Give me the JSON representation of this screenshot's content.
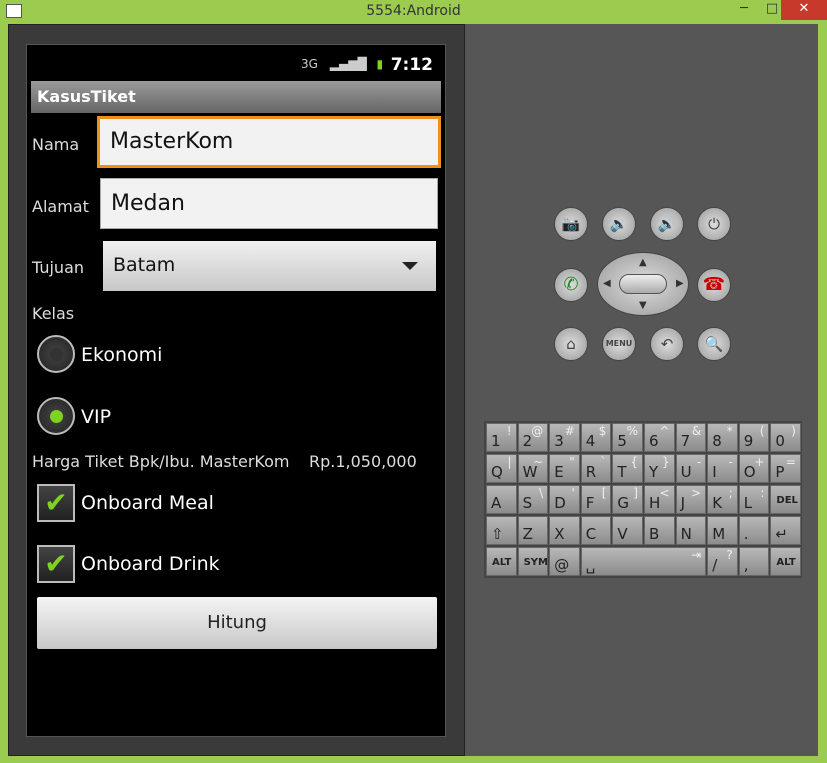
{
  "window": {
    "title": "5554:Android",
    "minimize": "─",
    "maximize": "□",
    "close": "✕"
  },
  "status": {
    "time": "7:12",
    "icons": [
      "3g-icon",
      "signal-icon",
      "battery-charging-icon"
    ]
  },
  "app": {
    "title": "KasusTiket",
    "nama_label": "Nama",
    "nama_value": "MasterKom",
    "alamat_label": "Alamat",
    "alamat_value": "Medan",
    "tujuan_label": "Tujuan",
    "tujuan_value": "Batam",
    "kelas_label": "Kelas",
    "kelas_options": [
      {
        "label": "Ekonomi",
        "selected": false
      },
      {
        "label": "VIP",
        "selected": true
      }
    ],
    "harga_label": "Harga Tiket Bpk/Ibu. MasterKom",
    "harga_value": "Rp.1,050,000",
    "onboard_meal": {
      "label": "Onboard Meal",
      "checked": true
    },
    "onboard_drink": {
      "label": "Onboard Drink",
      "checked": true
    },
    "hitung_label": "Hitung"
  },
  "controls": {
    "menu_label": "MENU"
  },
  "keyboard": {
    "rows": [
      [
        [
          "1",
          "!"
        ],
        [
          "2",
          "@"
        ],
        [
          "3",
          "#"
        ],
        [
          "4",
          "$"
        ],
        [
          "5",
          "%"
        ],
        [
          "6",
          "^"
        ],
        [
          "7",
          "&"
        ],
        [
          "8",
          "*"
        ],
        [
          "9",
          "("
        ],
        [
          "0",
          ")"
        ]
      ],
      [
        [
          "Q",
          "|"
        ],
        [
          "W",
          "~"
        ],
        [
          "E",
          "\""
        ],
        [
          "R",
          "`"
        ],
        [
          "T",
          "{"
        ],
        [
          "Y",
          "}"
        ],
        [
          "U",
          "-"
        ],
        [
          "I",
          "-"
        ],
        [
          "O",
          "+"
        ],
        [
          "P",
          "="
        ]
      ],
      [
        [
          "A",
          ""
        ],
        [
          "S",
          "\\"
        ],
        [
          "D",
          "'"
        ],
        [
          "F",
          "["
        ],
        [
          "G",
          "]"
        ],
        [
          "H",
          "<"
        ],
        [
          "J",
          ">"
        ],
        [
          "K",
          ";"
        ],
        [
          "L",
          ":"
        ],
        [
          "DEL",
          ""
        ]
      ],
      [
        [
          "⇧",
          ""
        ],
        [
          "Z",
          ""
        ],
        [
          "X",
          ""
        ],
        [
          "C",
          ""
        ],
        [
          "V",
          ""
        ],
        [
          "B",
          ""
        ],
        [
          "N",
          ""
        ],
        [
          "M",
          ""
        ],
        [
          ".",
          ""
        ],
        [
          "↵",
          ""
        ]
      ],
      [
        [
          "ALT",
          ""
        ],
        [
          "SYM",
          ""
        ],
        [
          "@",
          ""
        ],
        [
          "␣",
          "⇥"
        ],
        [
          "/",
          "?"
        ],
        [
          ",",
          ""
        ],
        [
          "ALT",
          ""
        ]
      ]
    ]
  }
}
